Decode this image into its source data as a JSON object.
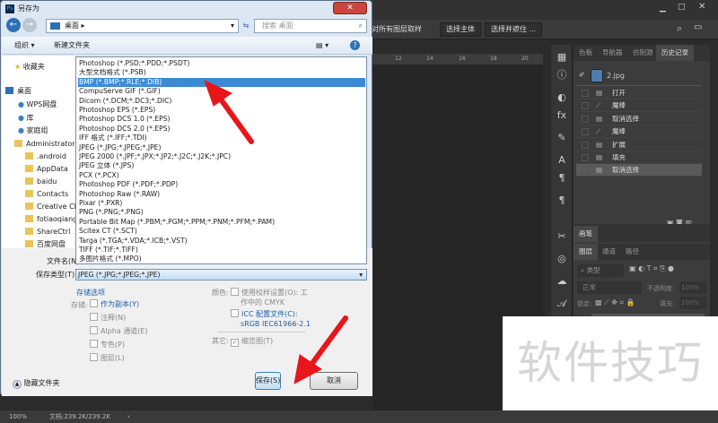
{
  "ps": {
    "options_text": "对所有图层取样",
    "select_subject": "选择主体",
    "select_mask": "选择并遮住 ...",
    "ruler_ticks": [
      "12",
      "14",
      "16",
      "18",
      "20"
    ],
    "panel_tabs": [
      "色板",
      "导航器",
      "仿制源",
      "历史记录"
    ],
    "snapshot": "2.jpg",
    "history": [
      "打开",
      "魔棒",
      "取消选择",
      "魔棒",
      "扩展",
      "填充",
      "取消选择"
    ],
    "brush_tab": "画笔",
    "layer_tabs": [
      "图层",
      "通道",
      "路径"
    ],
    "filter_type": "类型",
    "blend_mode": "正常",
    "opacity_label": "不透明度:",
    "opacity": "100%",
    "lock_label": "锁定:",
    "fill_label": "填充:",
    "fill": "100%",
    "zoom": "100%",
    "doc_info": "文档:239.2K/239.2K"
  },
  "dialog": {
    "title": "另存为",
    "address": "桌面",
    "search_placeholder": "搜索 桌面",
    "organize": "组织 ▾",
    "new_folder": "新建文件夹",
    "nav": [
      "收藏夹",
      "桌面",
      "WPS网盘",
      "库",
      "家庭组",
      "Administrator",
      ".android",
      "AppData",
      "baidu",
      "Contacts",
      "Creative Cloud",
      "fotiaoqiang",
      "ShareCtrl",
      "百度网盘"
    ],
    "formats": [
      "Photoshop (*.PSD;*.PDD;*.PSDT)",
      "大型文档格式 (*.PSB)",
      "BMP (*.BMP;*.RLE;*.DIB)",
      "CompuServe GIF (*.GIF)",
      "Dicom (*.DCM;*.DC3;*.DIC)",
      "Photoshop EPS (*.EPS)",
      "Photoshop DCS 1.0 (*.EPS)",
      "Photoshop DCS 2.0 (*.EPS)",
      "IFF 格式 (*.IFF;*.TDI)",
      "JPEG (*.JPG;*.JPEG;*.JPE)",
      "JPEG 2000 (*.JPF;*.JPX;*.JP2;*.J2C;*.J2K;*.JPC)",
      "JPEG 立体 (*.JPS)",
      "PCX (*.PCX)",
      "Photoshop PDF (*.PDF;*.PDP)",
      "Photoshop Raw (*.RAW)",
      "Pixar (*.PXR)",
      "PNG (*.PNG;*.PNG)",
      "Portable Bit Map (*.PBM;*.PGM;*.PPM;*.PNM;*.PFM;*.PAM)",
      "Scitex CT (*.SCT)",
      "Targa (*.TGA;*.VDA;*.ICB;*.VST)",
      "TIFF (*.TIF;*.TIFF)",
      "多图片格式 (*.MPO)"
    ],
    "selected_index": 2,
    "filename_label": "文件名(N):",
    "type_label": "保存类型(T):",
    "type_value": "JPEG (*.JPG;*.JPEG;*.JPE)",
    "save_options": "存储选项",
    "save_label": "存储:",
    "as_copy": "作为副本(Y)",
    "notes": "注释(N)",
    "alpha": "Alpha 通道(E)",
    "spot": "专色(P)",
    "layers": "图层(L)",
    "color_label": "颜色:",
    "proof": "使用校样设置(O): 工",
    "proof2": "作中的 CMYK",
    "icc": "ICC 配置文件(C):",
    "icc_profile": "sRGB IEC61966-2.1",
    "other_label": "其它:",
    "thumbnail": "缩览图(T)",
    "hide_folders": "隐藏文件夹",
    "save": "保存(S)",
    "cancel": "取消"
  },
  "watermark": "软件技巧"
}
